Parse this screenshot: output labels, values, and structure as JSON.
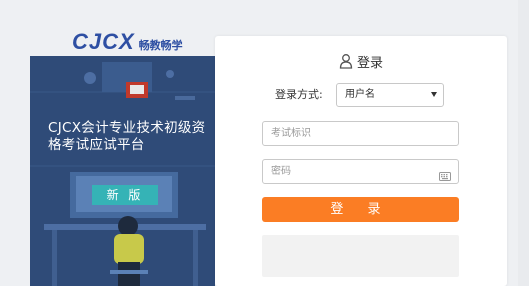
{
  "logo": {
    "main": "CJCX",
    "sub": "畅教畅学"
  },
  "banner": {
    "title": "CJCX会计专业技术初级资格考试应试平台",
    "badge": "新 版"
  },
  "login": {
    "title": "登录",
    "method_label": "登录方式:",
    "method_value": "用户名",
    "exam_id_placeholder": "考试标识",
    "password_placeholder": "密码",
    "submit_label": "登 录"
  },
  "colors": {
    "accent": "#fb7d24",
    "brand": "#2e4fa3",
    "banner_bg": "#2f4b78",
    "badge": "#35b3b6"
  }
}
